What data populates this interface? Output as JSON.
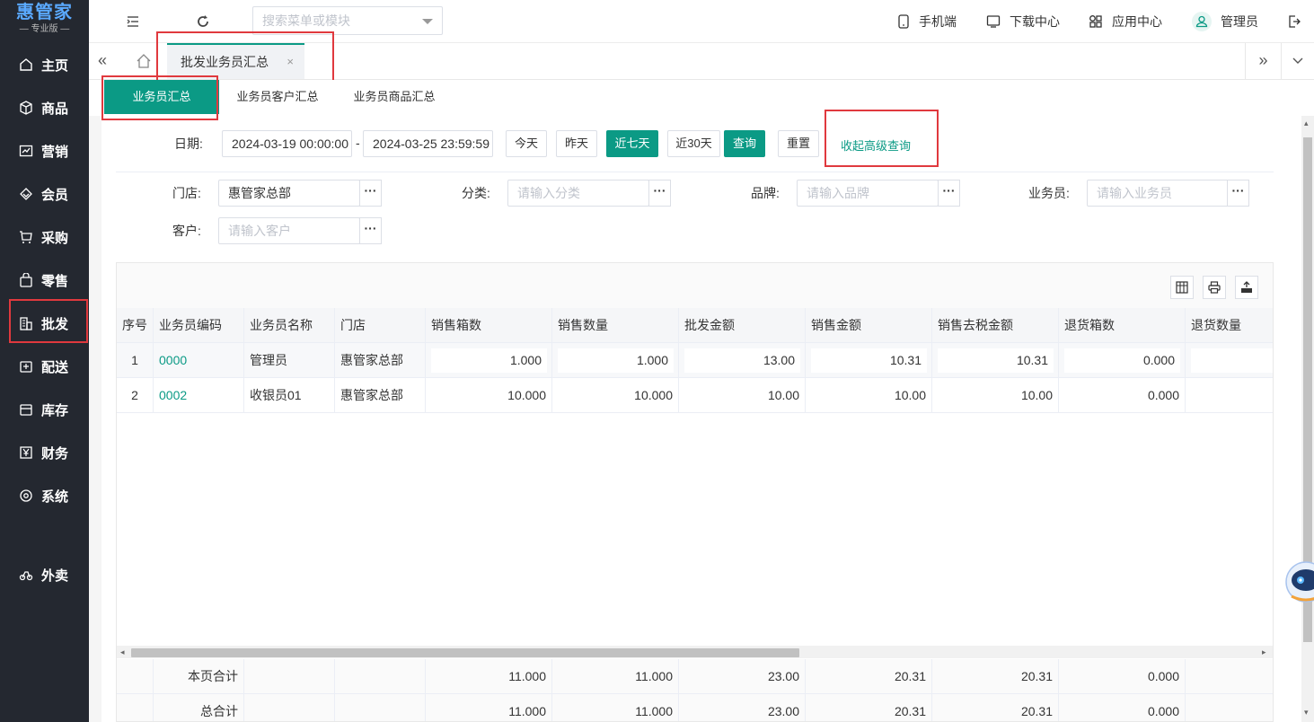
{
  "sidebar": {
    "logo_main": "惠管家",
    "logo_sub": "— 专业版 —",
    "items": [
      {
        "label": "主页",
        "icon": "home-icon"
      },
      {
        "label": "商品",
        "icon": "box-icon"
      },
      {
        "label": "营销",
        "icon": "chart-icon"
      },
      {
        "label": "会员",
        "icon": "diamond-icon"
      },
      {
        "label": "采购",
        "icon": "cart-icon"
      },
      {
        "label": "零售",
        "icon": "bag-icon"
      },
      {
        "label": "批发",
        "icon": "building-icon"
      },
      {
        "label": "配送",
        "icon": "truck-icon"
      },
      {
        "label": "库存",
        "icon": "inventory-icon"
      },
      {
        "label": "财务",
        "icon": "yen-icon"
      },
      {
        "label": "系统",
        "icon": "settings-icon"
      },
      {
        "label": "外卖",
        "icon": "bike-icon"
      }
    ]
  },
  "topbar": {
    "search_placeholder": "搜索菜单或模块",
    "mobile": "手机端",
    "download": "下载中心",
    "apps": "应用中心",
    "user": "管理员"
  },
  "tabs": {
    "current": "批发业务员汇总",
    "close": "×"
  },
  "subtabs": [
    "业务员汇总",
    "业务员客户汇总",
    "业务员商品汇总"
  ],
  "filters": {
    "date_label": "日期:",
    "date_start": "2024-03-19 00:00:00",
    "date_sep": "-",
    "date_end": "2024-03-25 23:59:59",
    "btn_today": "今天",
    "btn_yesterday": "昨天",
    "btn_7days": "近七天",
    "btn_30days": "近30天",
    "btn_query": "查询",
    "btn_reset": "重置",
    "advanced_link": "收起高级查询",
    "store_label": "门店:",
    "store_value": "惠管家总部",
    "category_label": "分类:",
    "category_placeholder": "请输入分类",
    "brand_label": "品牌:",
    "brand_placeholder": "请输入品牌",
    "salesman_label": "业务员:",
    "salesman_placeholder": "请输入业务员",
    "customer_label": "客户:",
    "customer_placeholder": "请输入客户",
    "dots": "···"
  },
  "table": {
    "columns": [
      "序号",
      "业务员编码",
      "业务员名称",
      "门店",
      "销售箱数",
      "销售数量",
      "批发金额",
      "销售金额",
      "销售去税金额",
      "退货箱数",
      "退货数量"
    ],
    "rows": [
      [
        "1",
        "0000",
        "管理员",
        "惠管家总部",
        "1.000",
        "1.000",
        "13.00",
        "10.31",
        "10.31",
        "0.000",
        ""
      ],
      [
        "2",
        "0002",
        "收银员01",
        "惠管家总部",
        "10.000",
        "10.000",
        "10.00",
        "10.00",
        "10.00",
        "0.000",
        ""
      ]
    ],
    "page_total_label": "本页合计",
    "page_total": [
      "11.000",
      "11.000",
      "23.00",
      "20.31",
      "20.31",
      "0.000"
    ],
    "grand_total_label": "总合计",
    "grand_total": [
      "11.000",
      "11.000",
      "23.00",
      "20.31",
      "20.31",
      "0.000"
    ]
  },
  "colors": {
    "accent": "#0b9a85",
    "sidebar": "#242830",
    "highlight": "#e0393e"
  }
}
